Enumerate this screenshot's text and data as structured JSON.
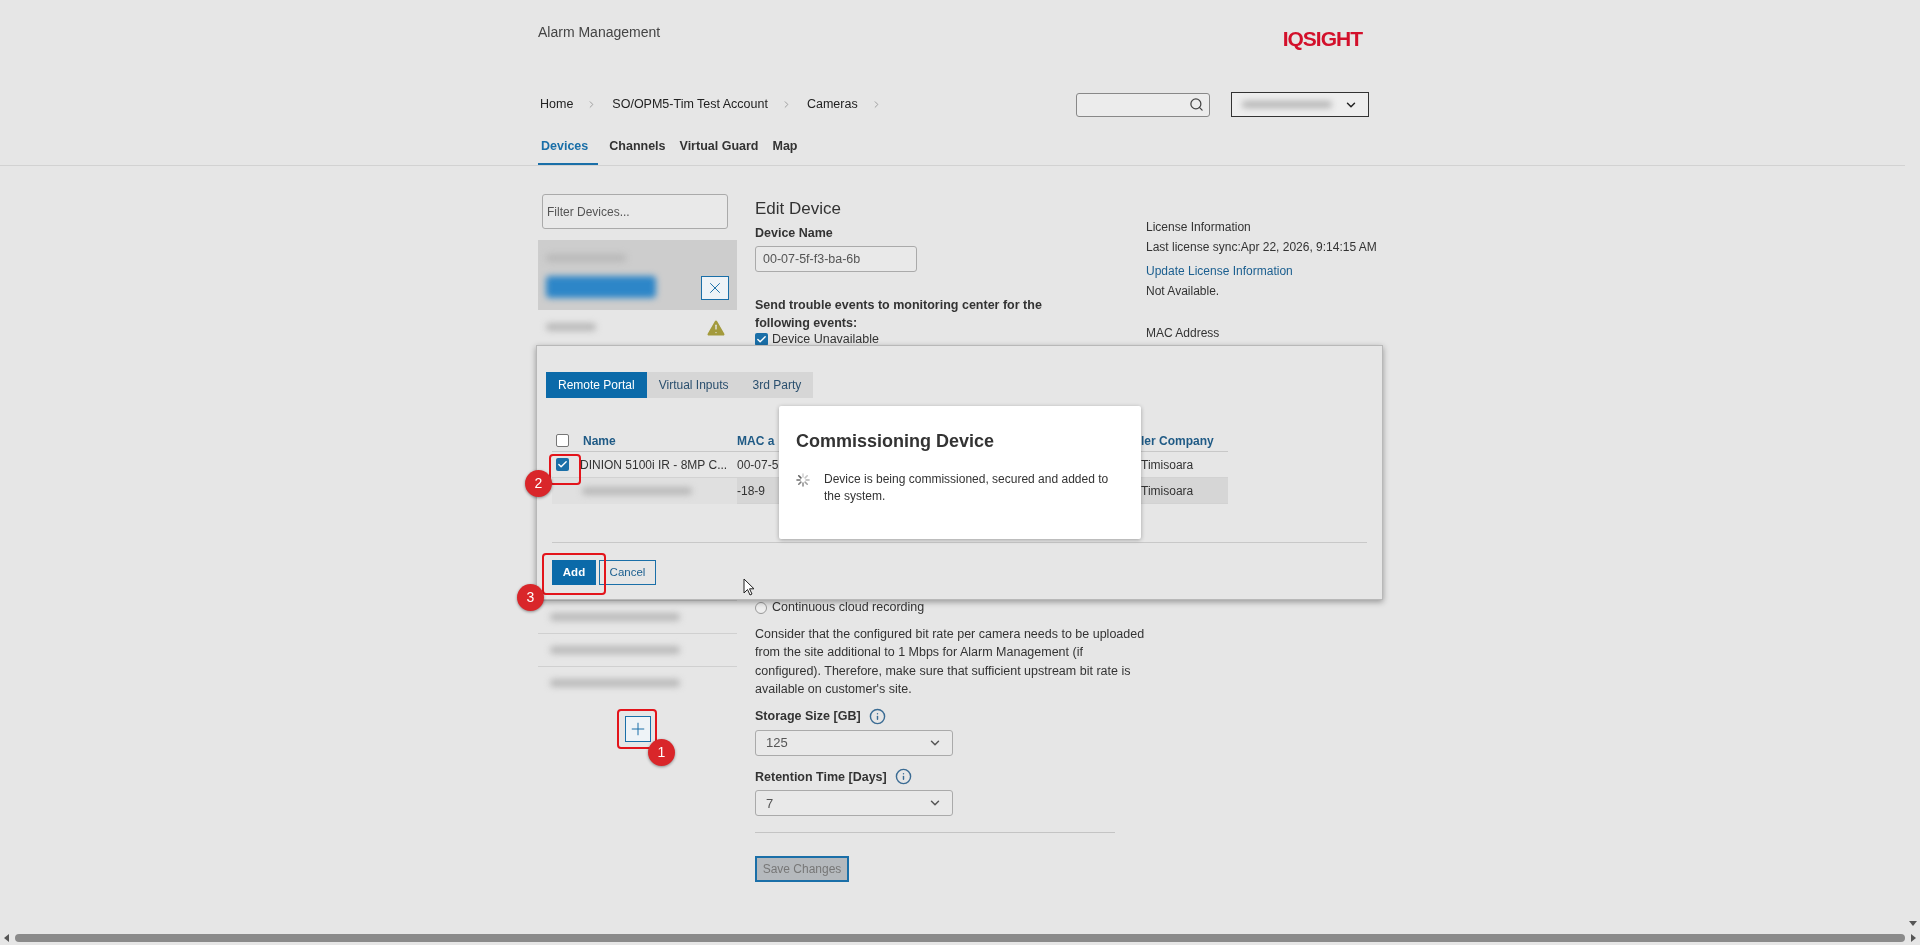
{
  "header": {
    "title": "Alarm Management",
    "logo": "IQSIGHT"
  },
  "breadcrumb": [
    {
      "label": "Home"
    },
    {
      "label": "SO/OPM5-Tim Test Account"
    },
    {
      "label": "Cameras"
    }
  ],
  "nav_tabs": [
    {
      "label": "Devices",
      "selected": true
    },
    {
      "label": "Channels",
      "selected": false
    },
    {
      "label": "Virtual Guard",
      "selected": false
    },
    {
      "label": "Map",
      "selected": false
    }
  ],
  "device_filter": {
    "placeholder": "Filter Devices..."
  },
  "device_list_top": [
    {
      "selected": true,
      "warning": false
    },
    {
      "selected": false,
      "warning": true
    }
  ],
  "device_list_bottom": [
    {
      "selected": false,
      "warning": false
    },
    {
      "selected": false,
      "warning": false
    },
    {
      "selected": false,
      "warning": false
    }
  ],
  "edit_device": {
    "title": "Edit Device",
    "device_name_label": "Device Name",
    "device_name": "00-07-5f-f3-ba-6b",
    "trouble_events_label": "Send trouble events to monitoring center for the following events:",
    "events": [
      {
        "label": "Device Unavailable",
        "checked": true
      }
    ],
    "recording_option": {
      "label": "Continuous cloud recording",
      "selected": false
    },
    "bitrate_note": "Consider that the configured bit rate per camera needs to be uploaded from the site additional to 1 Mbps for Alarm Management (if configured). Therefore, make sure that sufficient upstream bit rate is available on customer's site.",
    "storage_size": {
      "label": "Storage Size [GB]",
      "value": "125"
    },
    "retention_time": {
      "label": "Retention Time [Days]",
      "value": "7"
    },
    "save_button": {
      "label": "Save Changes",
      "disabled": true
    }
  },
  "license": {
    "title": "License Information",
    "last_sync": "Last license sync:Apr 22, 2026, 9:14:15 AM",
    "update_link": "Update License Information",
    "status": "Not Available.",
    "mac_label": "MAC Address"
  },
  "add_device_modal": {
    "tabs": [
      {
        "label": "Remote Portal",
        "selected": true
      },
      {
        "label": "Virtual Inputs",
        "selected": false
      },
      {
        "label": "3rd Party",
        "selected": false
      }
    ],
    "select_all_checked": false,
    "columns": [
      "Name",
      "MAC a",
      "ler Company"
    ],
    "rows": [
      {
        "kind": "plain",
        "checked": true,
        "highlighted": false,
        "name": "DINION 5100i IR - 8MP C...",
        "mac": "00-07-5",
        "company": "Timisoara"
      },
      {
        "kind": "redacted",
        "highlighted": true,
        "mac": "-18-9",
        "company": "Timisoara"
      }
    ],
    "add_button": "Add",
    "cancel_button": "Cancel"
  },
  "commissioning_dialog": {
    "title": "Commissioning Device",
    "message": "Device is being commissioned, secured and added to the system."
  },
  "annotations": [
    {
      "label": "1"
    },
    {
      "label": "2"
    },
    {
      "label": "3"
    }
  ]
}
